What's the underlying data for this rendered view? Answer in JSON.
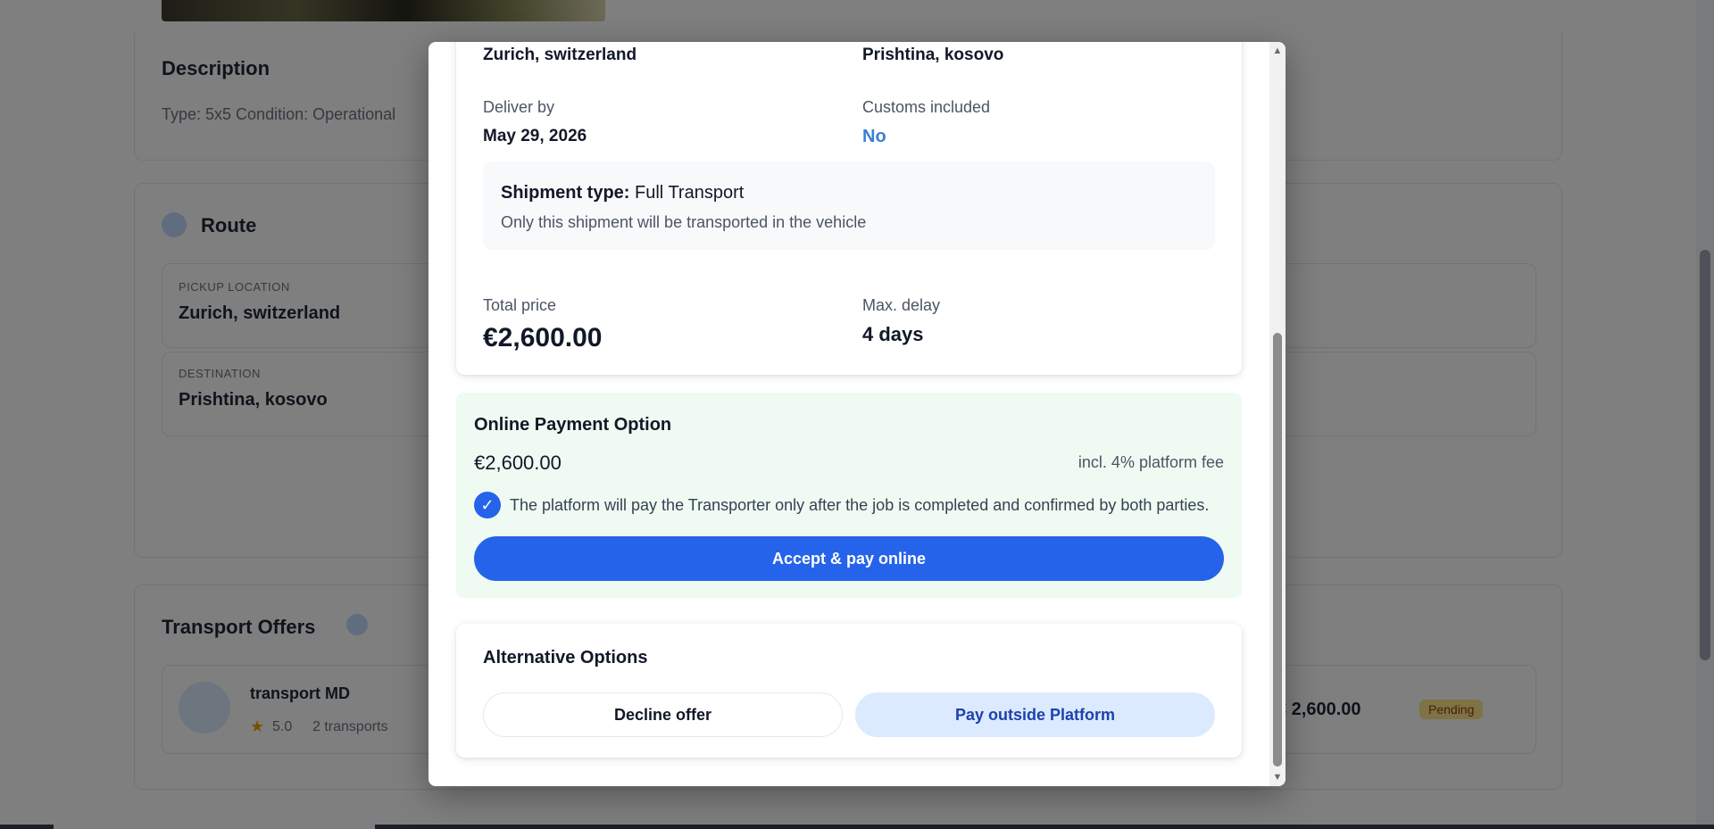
{
  "background": {
    "description_heading": "Description",
    "description_text": "Type: 5x5  Condition: Operational",
    "route_heading": "Route",
    "pickup_label": "PICKUP LOCATION",
    "pickup_value": "Zurich, switzerland",
    "destination_label": "DESTINATION",
    "destination_value": "Prishtina, kosovo",
    "offers_heading": "Transport Offers",
    "offer_company": "transport MD",
    "offer_rating": "5.0",
    "offer_transports": "2 transports",
    "offer_price": "€ 2,600.00",
    "offer_status": "Pending"
  },
  "modal": {
    "route": {
      "from": "Zurich, switzerland",
      "to": "Prishtina, kosovo",
      "deliver_by_label": "Deliver by",
      "deliver_by_value": "May 29, 2026",
      "customs_label": "Customs included",
      "customs_value": "No",
      "shipment_type_label": "Shipment type:",
      "shipment_type_value": "Full Transport",
      "shipment_type_note": "Only this shipment will be transported in the vehicle",
      "total_price_label": "Total price",
      "total_price_value": "€2,600.00",
      "max_delay_label": "Max. delay",
      "max_delay_value": "4 days"
    },
    "online_payment": {
      "title": "Online Payment Option",
      "amount": "€2,600.00",
      "fee_note": "incl. 4% platform fee",
      "check_glyph": "✓",
      "guarantee_note": "The platform will pay the Transporter only after the job is completed and confirmed by both parties.",
      "accept_button": "Accept & pay online"
    },
    "alternative": {
      "title": "Alternative Options",
      "decline_button": "Decline offer",
      "pay_outside_button": "Pay outside Platform"
    },
    "scroll": {
      "up_glyph": "▲",
      "down_glyph": "▼"
    }
  },
  "colors": {
    "primary": "#2563eb",
    "success_bg": "#effbf2",
    "link": "#3b7fd3",
    "soft_button": "#dbeafe"
  }
}
